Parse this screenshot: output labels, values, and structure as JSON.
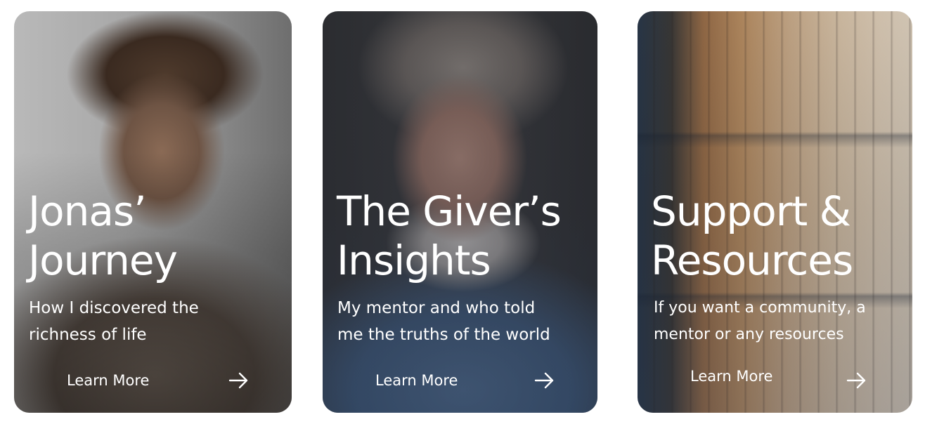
{
  "cards": [
    {
      "title_lines": [
        "Jonas’",
        "Journey"
      ],
      "subtitle_lines": [
        "How I discovered the",
        "richness of life"
      ],
      "cta_label": "Learn More",
      "cta_icon": "arrow-right-icon",
      "image": "portrait of young man"
    },
    {
      "title_lines": [
        "The Giver’s",
        "Insights"
      ],
      "subtitle_lines": [
        "My mentor and who told",
        "me the truths of the world"
      ],
      "cta_label": "Learn More",
      "cta_icon": "arrow-right-icon",
      "image": "portrait of older bearded man"
    },
    {
      "title_lines": [
        "Support &",
        "Resources"
      ],
      "subtitle_lines": [
        "If you want a community, a",
        "mentor or any resources"
      ],
      "cta_label": "Learn More",
      "cta_icon": "arrow-right-icon",
      "image": "library bookshelves"
    }
  ],
  "colors": {
    "text": "#ffffff",
    "page_background": "#ffffff"
  }
}
